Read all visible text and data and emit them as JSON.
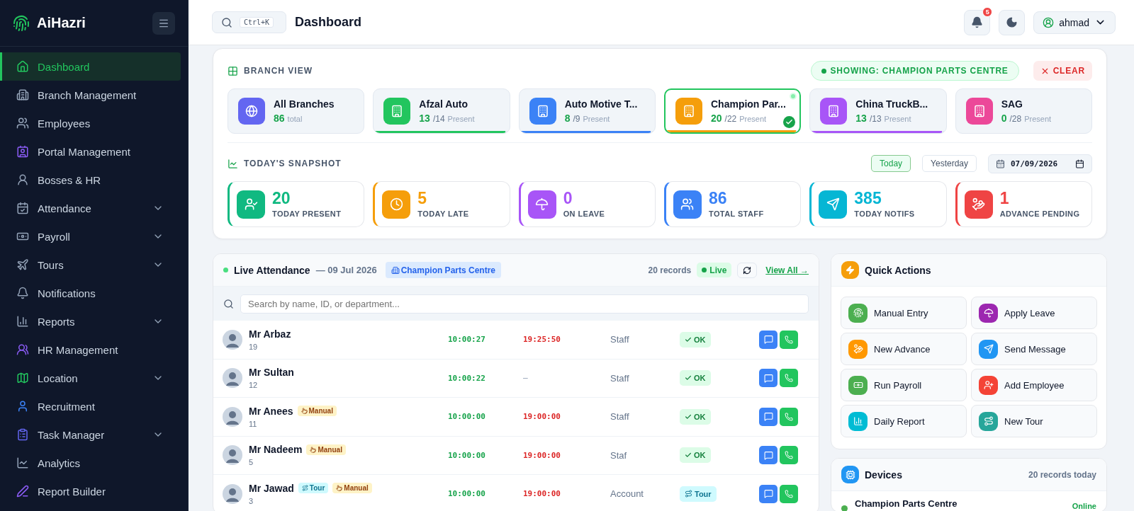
{
  "sidebar": {
    "brand": "AiHazri",
    "items": [
      {
        "label": "Dashboard",
        "kind": "link",
        "selected": true
      },
      {
        "label": "Branch Management",
        "kind": "link",
        "selected": false
      },
      {
        "label": "Employees",
        "kind": "link",
        "selected": false
      },
      {
        "label": "Portal Management",
        "kind": "link",
        "selected": false
      },
      {
        "label": "Bosses & HR",
        "kind": "link",
        "selected": false
      },
      {
        "label": "Attendance",
        "kind": "group",
        "selected": false
      },
      {
        "label": "Payroll",
        "kind": "group",
        "selected": false
      },
      {
        "label": "Tours",
        "kind": "group",
        "selected": false
      },
      {
        "label": "Notifications",
        "kind": "link",
        "selected": false
      },
      {
        "label": "Reports",
        "kind": "group",
        "selected": false
      },
      {
        "label": "HR Management",
        "kind": "link",
        "selected": false
      },
      {
        "label": "Location",
        "kind": "group",
        "selected": false
      },
      {
        "label": "Recruitment",
        "kind": "link",
        "selected": false
      },
      {
        "label": "Task Manager",
        "kind": "group",
        "selected": false
      },
      {
        "label": "Analytics",
        "kind": "link",
        "selected": false
      },
      {
        "label": "Report Builder",
        "kind": "link",
        "selected": false
      }
    ]
  },
  "header": {
    "shortcut": "Ctrl+K",
    "title": "Dashboard",
    "notifications": "5",
    "user": "ahmad"
  },
  "branch_view": {
    "title": "BRANCH VIEW",
    "showing_label": "SHOWING:",
    "showing_value": "CHAMPION PARTS CENTRE",
    "clear": "CLEAR",
    "branches": [
      {
        "kind": "all",
        "name": "All Branches",
        "present": "86",
        "suffix": "total",
        "color": "#6366f1",
        "selected": false
      },
      {
        "kind": "branch",
        "name": "Afzal Auto",
        "present": "13",
        "total": "/14",
        "suffix": "Present",
        "color": "#22c55e",
        "level": 0.97,
        "selected": false
      },
      {
        "kind": "branch",
        "name": "Auto Motive T...",
        "present": "8",
        "total": "/9",
        "suffix": "Present",
        "color": "#3b82f6",
        "level": 0.97,
        "selected": false
      },
      {
        "kind": "branch",
        "name": "Champion Par...",
        "present": "20",
        "total": "/22",
        "suffix": "Present",
        "color": "#f59e0b",
        "level": 0.97,
        "selected": true
      },
      {
        "kind": "branch",
        "name": "China TruckB...",
        "present": "13",
        "total": "/13",
        "suffix": "Present",
        "color": "#a855f7",
        "level": 0.97,
        "selected": false
      },
      {
        "kind": "branch",
        "name": "SAG",
        "present": "0",
        "total": "/28",
        "suffix": "Present",
        "color": "#ec4899",
        "selected": false
      }
    ]
  },
  "snapshot": {
    "title": "TODAY'S SNAPSHOT",
    "filters": [
      {
        "label": "Today",
        "selected": true
      },
      {
        "label": "Yesterday",
        "selected": false
      }
    ],
    "date": "07/09/2026",
    "stats": [
      {
        "value": "20",
        "label": "TODAY PRESENT",
        "color": "#10b981"
      },
      {
        "value": "5",
        "label": "TODAY LATE",
        "color": "#f59e0b"
      },
      {
        "value": "0",
        "label": "ON LEAVE",
        "color": "#a855f7"
      },
      {
        "value": "86",
        "label": "TOTAL STAFF",
        "color": "#3b82f6"
      },
      {
        "value": "385",
        "label": "TODAY NOTIFS",
        "color": "#06b6d4"
      },
      {
        "value": "1",
        "label": "ADVANCE PENDING",
        "color": "#ef4444"
      }
    ]
  },
  "live_attendance": {
    "title": "Live Attendance",
    "date": "— 09 Jul 2026",
    "branch": "Champion Parts Centre",
    "records": "20 records",
    "live": "Live",
    "view_all": "View All →",
    "search_placeholder": "Search by name, ID, or department...",
    "rows": [
      {
        "name": "Mr Arbaz",
        "id": "19",
        "tags": [],
        "check_in": "10:00:27",
        "check_out": "19:25:50",
        "department": "Staff",
        "status": {
          "label": "OK",
          "kind": "ok"
        }
      },
      {
        "name": "Mr Sultan",
        "id": "12",
        "tags": [],
        "check_in": "10:00:22",
        "check_out": "–",
        "department": "Staff",
        "status": {
          "label": "OK",
          "kind": "ok"
        }
      },
      {
        "name": "Mr Anees",
        "id": "11",
        "tags": [
          {
            "label": "Manual",
            "kind": "manual"
          }
        ],
        "check_in": "10:00:00",
        "check_out": "19:00:00",
        "department": "Staff",
        "status": {
          "label": "OK",
          "kind": "ok"
        }
      },
      {
        "name": "Mr Nadeem",
        "id": "5",
        "tags": [
          {
            "label": "Manual",
            "kind": "manual"
          }
        ],
        "check_in": "10:00:00",
        "check_out": "19:00:00",
        "department": "Staf",
        "status": {
          "label": "OK",
          "kind": "ok"
        }
      },
      {
        "name": "Mr Jawad",
        "id": "3",
        "tags": [
          {
            "label": "Tour",
            "kind": "tour"
          },
          {
            "label": "Manual",
            "kind": "manual"
          }
        ],
        "check_in": "10:00:00",
        "check_out": "19:00:00",
        "department": "Account",
        "status": {
          "label": "Tour",
          "kind": "tour"
        }
      }
    ]
  },
  "quick_actions": {
    "title": "Quick Actions",
    "actions": [
      {
        "label": "Manual Entry",
        "color": "#4caf50"
      },
      {
        "label": "Apply Leave",
        "color": "#9c27b0"
      },
      {
        "label": "New Advance",
        "color": "#ff9800"
      },
      {
        "label": "Send Message",
        "color": "#2196f3"
      },
      {
        "label": "Run Payroll",
        "color": "#4caf50"
      },
      {
        "label": "Add Employee",
        "color": "#f44336"
      },
      {
        "label": "Daily Report",
        "color": "#00bcd4"
      },
      {
        "label": "New Tour",
        "color": "#26a69a"
      }
    ]
  },
  "devices": {
    "title": "Devices",
    "count": "20 records today",
    "items": [
      {
        "name": "Champion Parts Centre",
        "status": "Online",
        "color": "#4caf50"
      }
    ]
  }
}
